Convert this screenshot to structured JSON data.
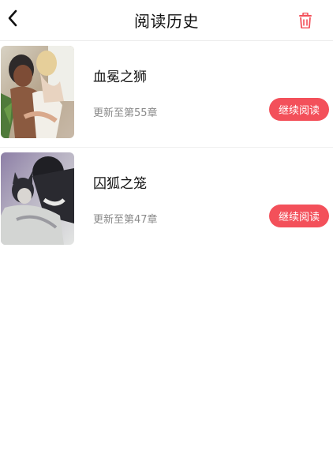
{
  "header": {
    "title": "阅读历史",
    "back_icon": "chevron-left-icon",
    "trash_icon": "trash-icon",
    "accent_color": "#f3505a"
  },
  "history": [
    {
      "title": "血冕之狮",
      "update": "更新至第55章",
      "button_label": "继续阅读"
    },
    {
      "title": "囚狐之笼",
      "update": "更新至第47章",
      "button_label": "继续阅读"
    }
  ]
}
